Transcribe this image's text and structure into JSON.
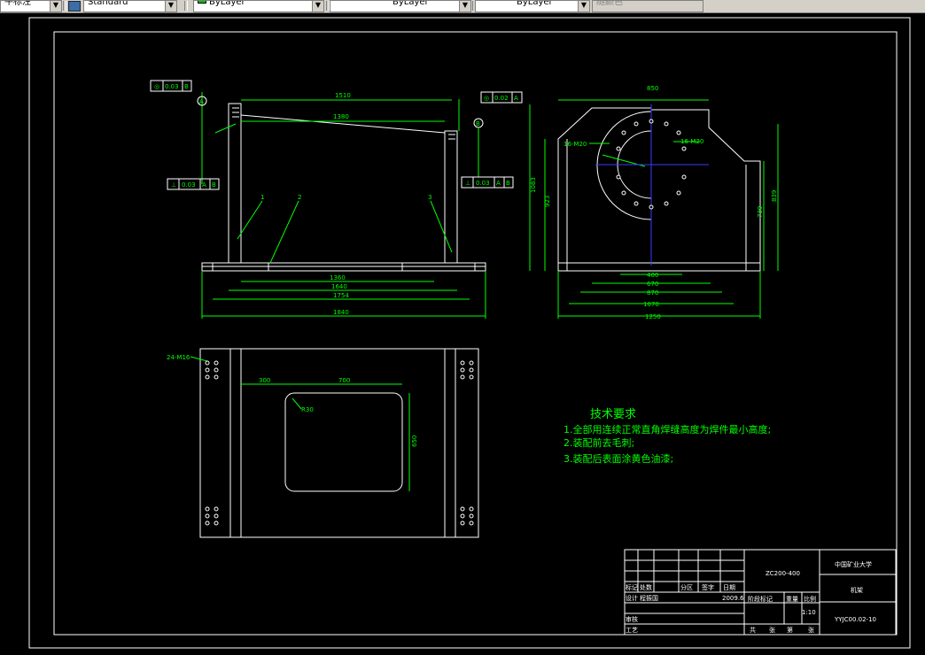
{
  "toolbar": {
    "text_style": "Standard",
    "layer": "ByLayer",
    "linetype": "ByLayer",
    "lineweight": "ByLayer",
    "plot_style": "随颜色"
  },
  "front_view": {
    "dim_width_top": "1510",
    "dim_inner": "1380",
    "dim_1360": "1360",
    "dim_1640": "1640",
    "dim_1754": "1754",
    "dim_1840": "1840",
    "tol_flat": "0.03",
    "tol_flat_ref": "B",
    "tol_par": "0.02",
    "tol_par_ref": "A",
    "tol_perp_left": "0.03",
    "tol_perp_left_ref1": "A",
    "tol_perp_left_ref2": "B",
    "tol_perp_right": "0.03",
    "tol_perp_right_ref1": "A",
    "tol_perp_right_ref2": "B",
    "datum_a": "A",
    "datum_b": "B",
    "part_1": "1",
    "part_2": "2",
    "part_3": "3"
  },
  "side_view": {
    "dim_top": "850",
    "dim_holes_left": "16-M20",
    "dim_holes_right": "16-M20",
    "dim_height": "1083",
    "dim_height2": "923",
    "dim_739": "739",
    "dim_839": "839",
    "dim_400": "400",
    "dim_670": "670",
    "dim_870": "870",
    "dim_1070": "1070",
    "dim_1250": "1250"
  },
  "top_view": {
    "holes": "24-M16",
    "dim_300": "300",
    "dim_700": "700",
    "dim_r30": "R30",
    "dim_650": "650"
  },
  "tech_notes": {
    "title": "技术要求",
    "lines": [
      "1.全部用连续正常直角焊缝高度为焊件最小高度;",
      "2.装配前去毛刺;",
      "3.装配后表面涂黄色油漆;"
    ]
  },
  "title_block": {
    "product": "ZC200-400",
    "school": "中国矿业大学",
    "part_name": "机架",
    "drawing_no": "YYJC00.02-10",
    "mark": "标记",
    "count": "处数",
    "zone": "分区",
    "signature": "签字",
    "date": "日期",
    "design": "设计",
    "designer": "程振国",
    "design_date": "2009.6",
    "stage": "阶段标记",
    "weight": "重量",
    "scale": "比例",
    "scale_value": "1:10",
    "review": "审核",
    "craft": "工艺",
    "total": "共",
    "sheet_unit1": "张",
    "page": "第",
    "sheet_unit2": "张"
  },
  "colors": {
    "line": "#ffffff",
    "dimension": "#00ff00",
    "center": "#3a3aff",
    "text": "#00ff00",
    "background": "#000000"
  }
}
